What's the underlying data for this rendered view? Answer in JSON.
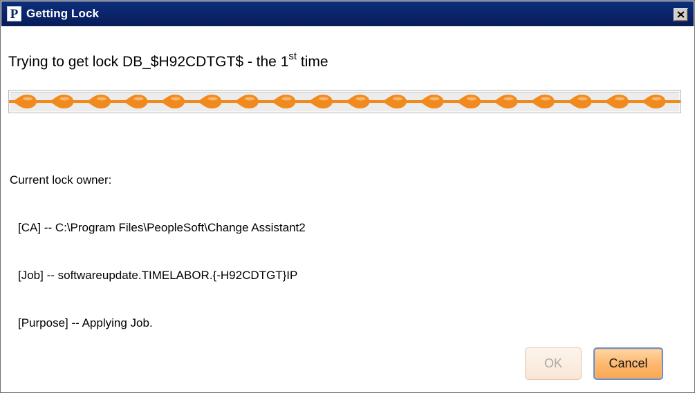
{
  "window": {
    "title": "Getting Lock",
    "app_icon_letter": "P",
    "close_label": "Close"
  },
  "message": {
    "prefix": "Trying to get lock DB_$H92CDTGT$ - the 1",
    "superscript": "st",
    "suffix": " time"
  },
  "progress": {
    "state": "indeterminate",
    "color": "#f08a1e"
  },
  "owner": {
    "heading": "Current lock owner:",
    "lines": [
      "[CA] -- C:\\Program Files\\PeopleSoft\\Change Assistant2",
      "[Job] -- softwareupdate.TIMELABOR.{-H92CDTGT}IP",
      "[Purpose] -- Applying Job."
    ]
  },
  "buttons": {
    "ok_label": "OK",
    "ok_enabled": false,
    "cancel_label": "Cancel"
  },
  "colors": {
    "titlebar": "#0a246a",
    "accent": "#f08a1e",
    "cancel_fill": "#fdb870"
  }
}
